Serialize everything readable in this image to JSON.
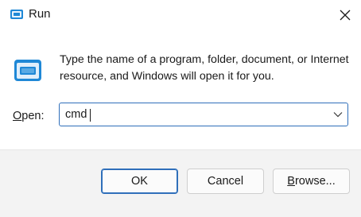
{
  "window": {
    "title": "Run",
    "close_icon": "close-icon",
    "title_icon": "run-app-icon"
  },
  "content": {
    "description": "Type the name of a program, folder, document, or Internet resource, and Windows will open it for you.",
    "open_label_accel": "O",
    "open_label_rest": "pen:",
    "open_value": "cmd"
  },
  "buttons": {
    "ok": "OK",
    "cancel": "Cancel",
    "browse_accel": "B",
    "browse_rest": "rowse..."
  },
  "colors": {
    "accent": "#2f6fba",
    "icon_blue": "#1f88d6"
  }
}
